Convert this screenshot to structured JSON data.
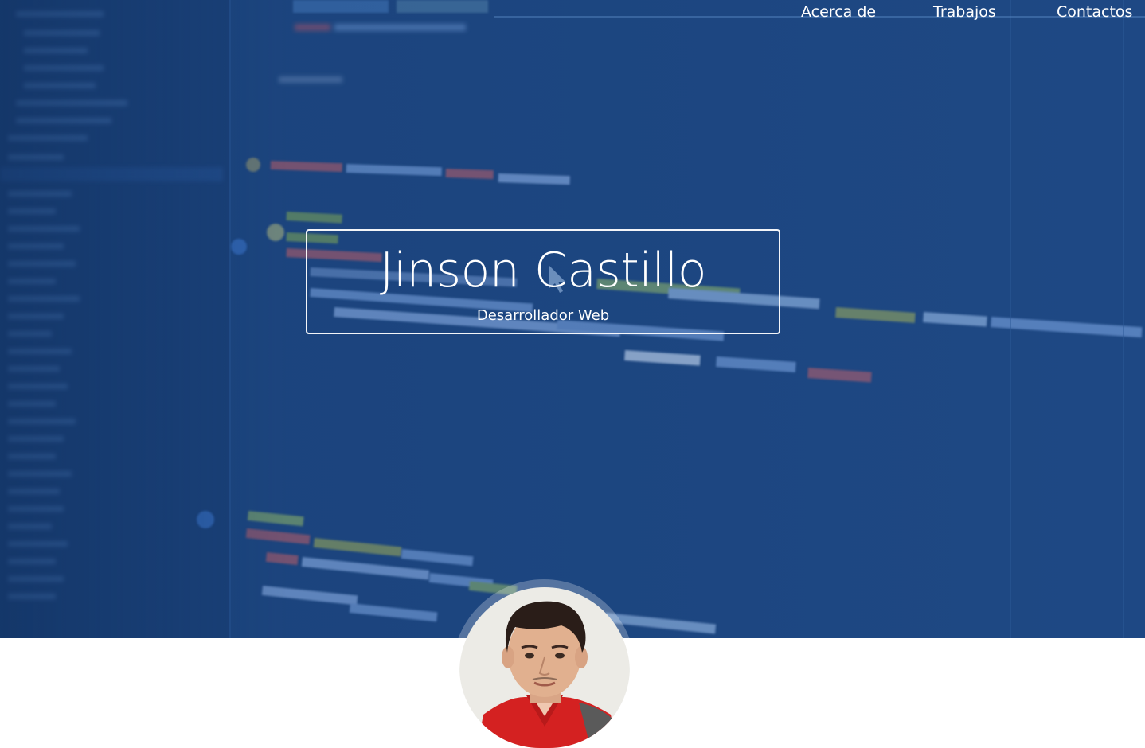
{
  "nav": {
    "items": [
      {
        "label": "Acerca de"
      },
      {
        "label": "Trabajos"
      },
      {
        "label": "Contactos"
      }
    ]
  },
  "hero": {
    "name": "Jinson Castillo",
    "role": "Desarrollador Web",
    "background_color": "#1d4a86"
  },
  "profile": {
    "photo_icon": "profile-photo",
    "shirt_color": "#d42121",
    "photo_bg": "#ecebe6"
  }
}
